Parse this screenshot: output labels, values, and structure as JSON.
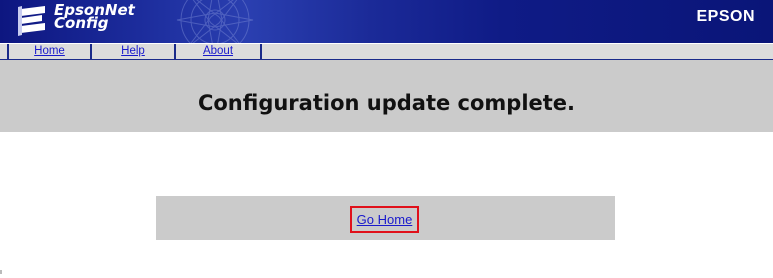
{
  "header": {
    "logo_line1": "EpsonNet",
    "logo_line2": "Config",
    "brand": "EPSON"
  },
  "nav": {
    "items": [
      {
        "label": "Home"
      },
      {
        "label": "Help"
      },
      {
        "label": "About"
      }
    ]
  },
  "main": {
    "title": "Configuration update complete.",
    "go_home_label": "Go Home"
  },
  "colors": {
    "header_bg": "#0d1680",
    "band_bg": "#cbcbcb",
    "link": "#1a1acc",
    "highlight": "#e0101a"
  }
}
